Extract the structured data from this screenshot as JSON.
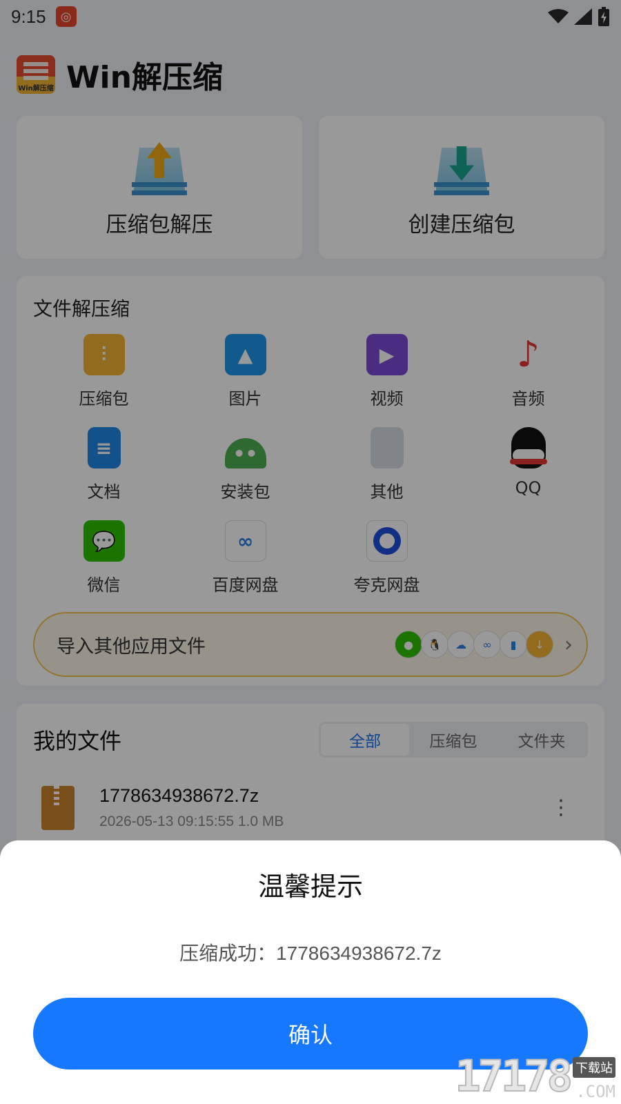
{
  "status": {
    "time": "9:15"
  },
  "app": {
    "title": "Win解压缩",
    "logo_text": "Win解压缩"
  },
  "actions": {
    "decompress": "压缩包解压",
    "create": "创建压缩包"
  },
  "extract": {
    "title": "文件解压缩",
    "items": [
      {
        "label": "压缩包",
        "icon": "folder-zip-icon",
        "color": "#f5b335"
      },
      {
        "label": "图片",
        "icon": "image-icon",
        "color": "#2196e9"
      },
      {
        "label": "视频",
        "icon": "video-icon",
        "color": "#7c4ad8"
      },
      {
        "label": "音频",
        "icon": "music-icon",
        "color": "#e53935"
      },
      {
        "label": "文档",
        "icon": "document-icon",
        "color": "#1e88e5"
      },
      {
        "label": "安装包",
        "icon": "android-icon",
        "color": "#4caf50"
      },
      {
        "label": "其他",
        "icon": "file-icon",
        "color": "#d8dce5"
      },
      {
        "label": "QQ",
        "icon": "qq-icon",
        "color": "#111111"
      },
      {
        "label": "微信",
        "icon": "wechat-icon",
        "color": "#2dc100"
      },
      {
        "label": "百度网盘",
        "icon": "baidu-netdisk-icon",
        "color": "#2a7de1"
      },
      {
        "label": "夸克网盘",
        "icon": "quark-netdisk-icon",
        "color": "#1f4fe0"
      }
    ],
    "import_label": "导入其他应用文件"
  },
  "files": {
    "title": "我的文件",
    "tabs": [
      "全部",
      "压缩包",
      "文件夹"
    ],
    "active_tab": "全部",
    "list": [
      {
        "name": "1778634938672.7z",
        "meta": "2026-05-13 09:15:55 1.0 MB"
      }
    ]
  },
  "dialog": {
    "title": "温馨提示",
    "message": "压缩成功：1778634938672.7z",
    "confirm": "确认"
  },
  "watermark": {
    "text": "17178",
    "tag": "下载站",
    "suffix": ".COM"
  }
}
